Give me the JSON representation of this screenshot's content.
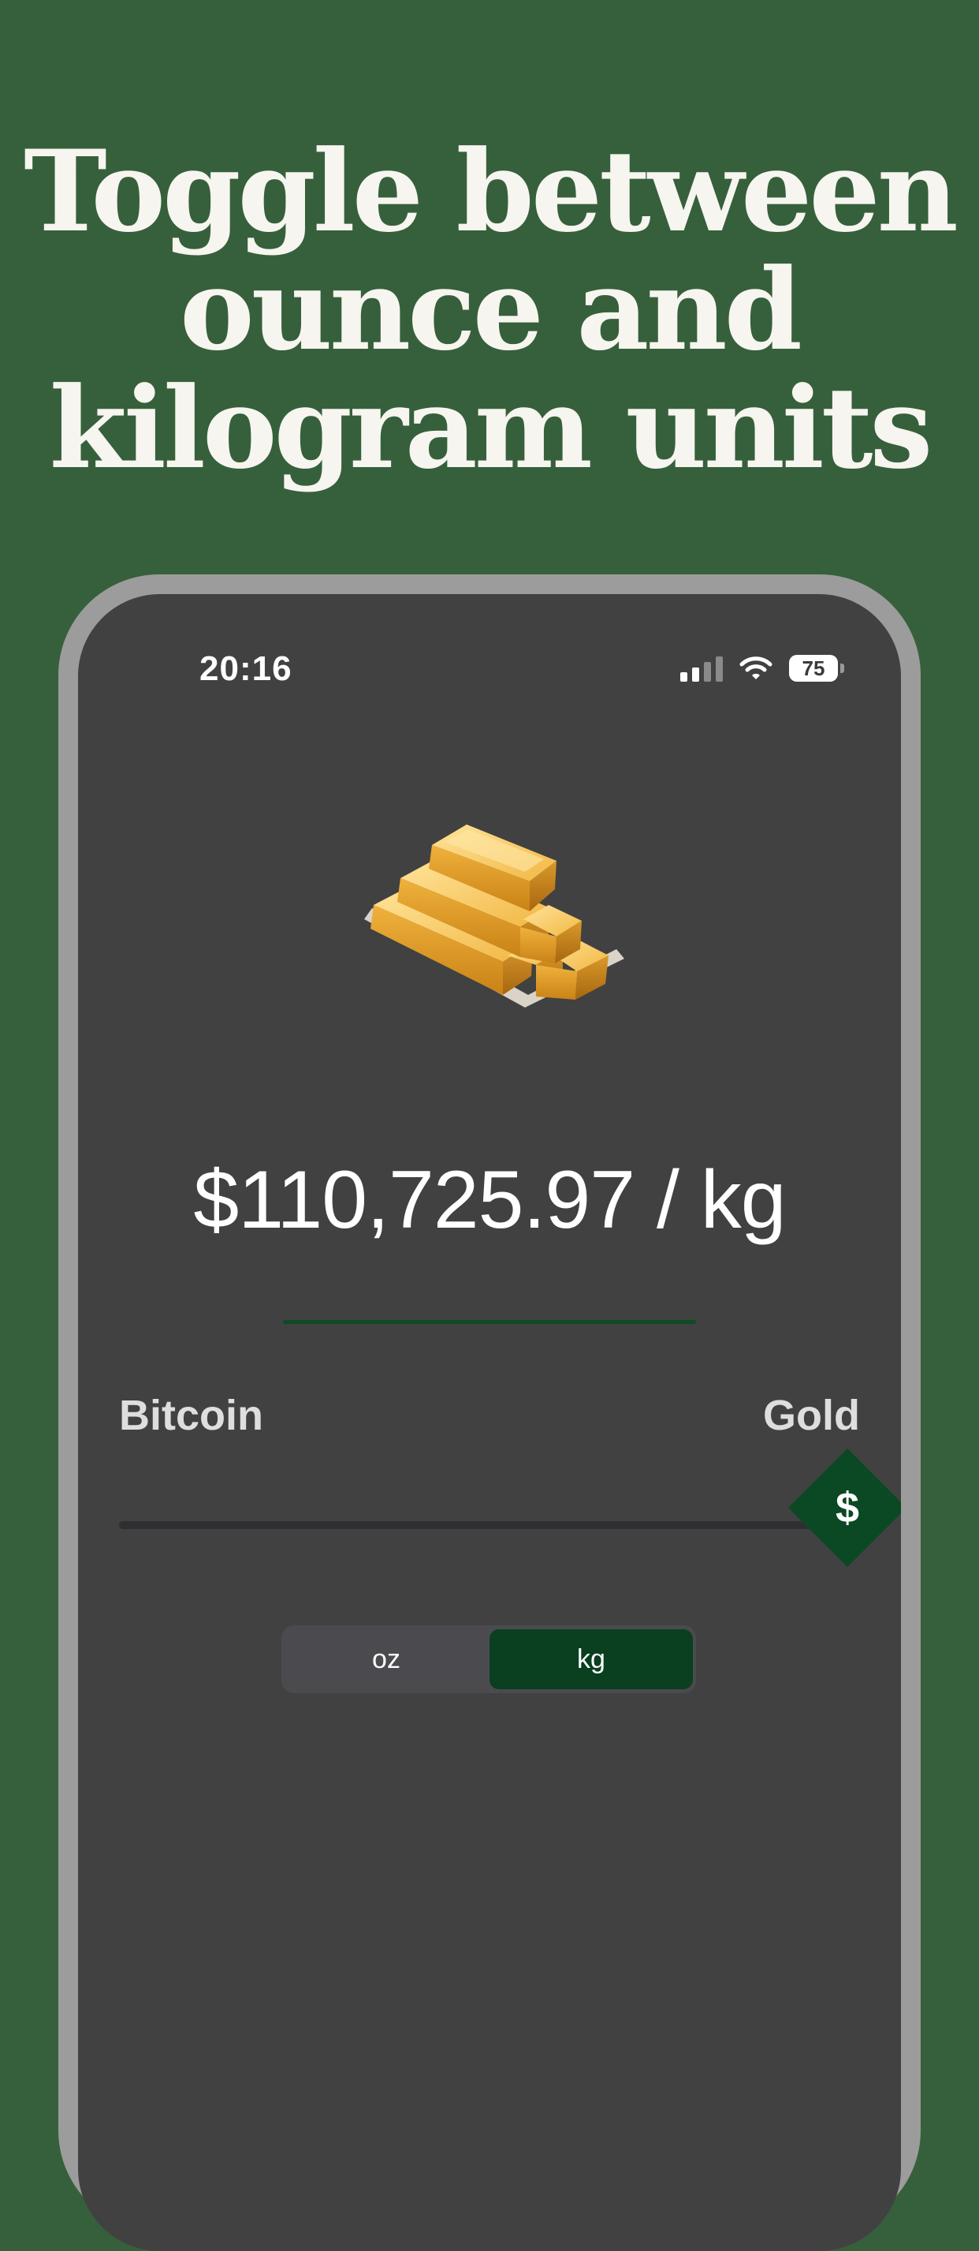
{
  "headline": [
    "Toggle between",
    "ounce and",
    "kilogram units"
  ],
  "status_bar": {
    "time": "20:16",
    "battery": "75"
  },
  "price": "$110,725.97 / kg",
  "slider": {
    "left_label": "Bitcoin",
    "right_label": "Gold",
    "thumb_symbol": "$",
    "position": 1.0
  },
  "unit_toggle": {
    "options": [
      "oz",
      "kg"
    ],
    "selected": "kg"
  },
  "colors": {
    "background": "#36603b",
    "screen": "#414141",
    "accent": "#0b4824"
  },
  "icons": {
    "hero": "gold-bars-icon",
    "signal": "cellular-signal-icon",
    "wifi": "wifi-icon",
    "battery": "battery-icon"
  }
}
